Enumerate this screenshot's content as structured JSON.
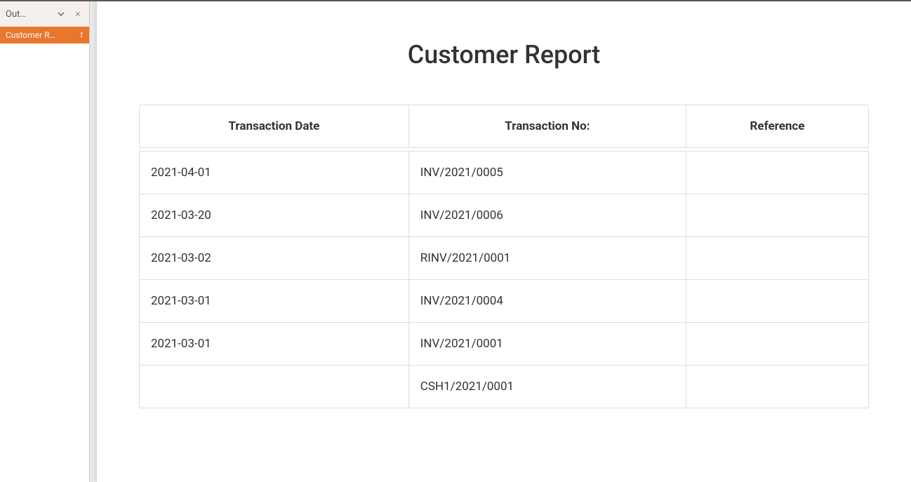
{
  "sidebar": {
    "header_label": "Out…",
    "tab": {
      "label": "Customer R…",
      "count": "1"
    }
  },
  "report": {
    "title": "Customer Report",
    "columns": {
      "date": "Transaction Date",
      "no": "Transaction No:",
      "ref": "Reference"
    },
    "rows": [
      {
        "date": "2021-04-01",
        "no": "INV/2021/0005",
        "ref": ""
      },
      {
        "date": "2021-03-20",
        "no": "INV/2021/0006",
        "ref": ""
      },
      {
        "date": "2021-03-02",
        "no": "RINV/2021/0001",
        "ref": ""
      },
      {
        "date": "2021-03-01",
        "no": "INV/2021/0004",
        "ref": ""
      },
      {
        "date": "2021-03-01",
        "no": "INV/2021/0001",
        "ref": ""
      },
      {
        "date": "",
        "no": "CSH1/2021/0001",
        "ref": ""
      }
    ]
  }
}
